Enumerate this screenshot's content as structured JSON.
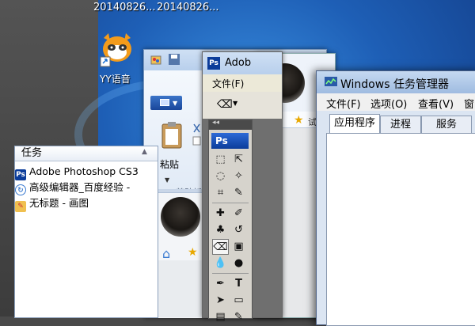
{
  "desktop": {
    "top_labels": [
      "20140826...",
      "20140826..."
    ],
    "icons": [
      {
        "label": "YY语音",
        "icon": "yy-raccoon-icon"
      }
    ]
  },
  "paint": {
    "clipboard_label": "粘贴",
    "group_label": "剪贴板"
  },
  "photoshop": {
    "title": "Adob",
    "menu_file": "文件(F)",
    "logo": "Ps"
  },
  "browser": {
    "star_text": "试"
  },
  "task_manager": {
    "title": "Windows 任务管理器",
    "menus": [
      "文件(F)",
      "选项(O)",
      "查看(V)",
      "窗"
    ],
    "tabs": [
      "应用程序",
      "进程",
      "服务"
    ],
    "active_tab": "应用程序",
    "column_header": "任务",
    "tasks": [
      {
        "name": "Adobe Photoshop CS3",
        "icon": "photoshop-icon"
      },
      {
        "name": "高级编辑器_百度经验 -",
        "icon": "browser-icon"
      },
      {
        "name": "无标题 - 画图",
        "icon": "paint-icon"
      }
    ]
  },
  "colors": {
    "desktop_blue": "#1e5fb6",
    "photoshop_blue": "#0b3c9a",
    "accent": "#2d6ad6"
  }
}
